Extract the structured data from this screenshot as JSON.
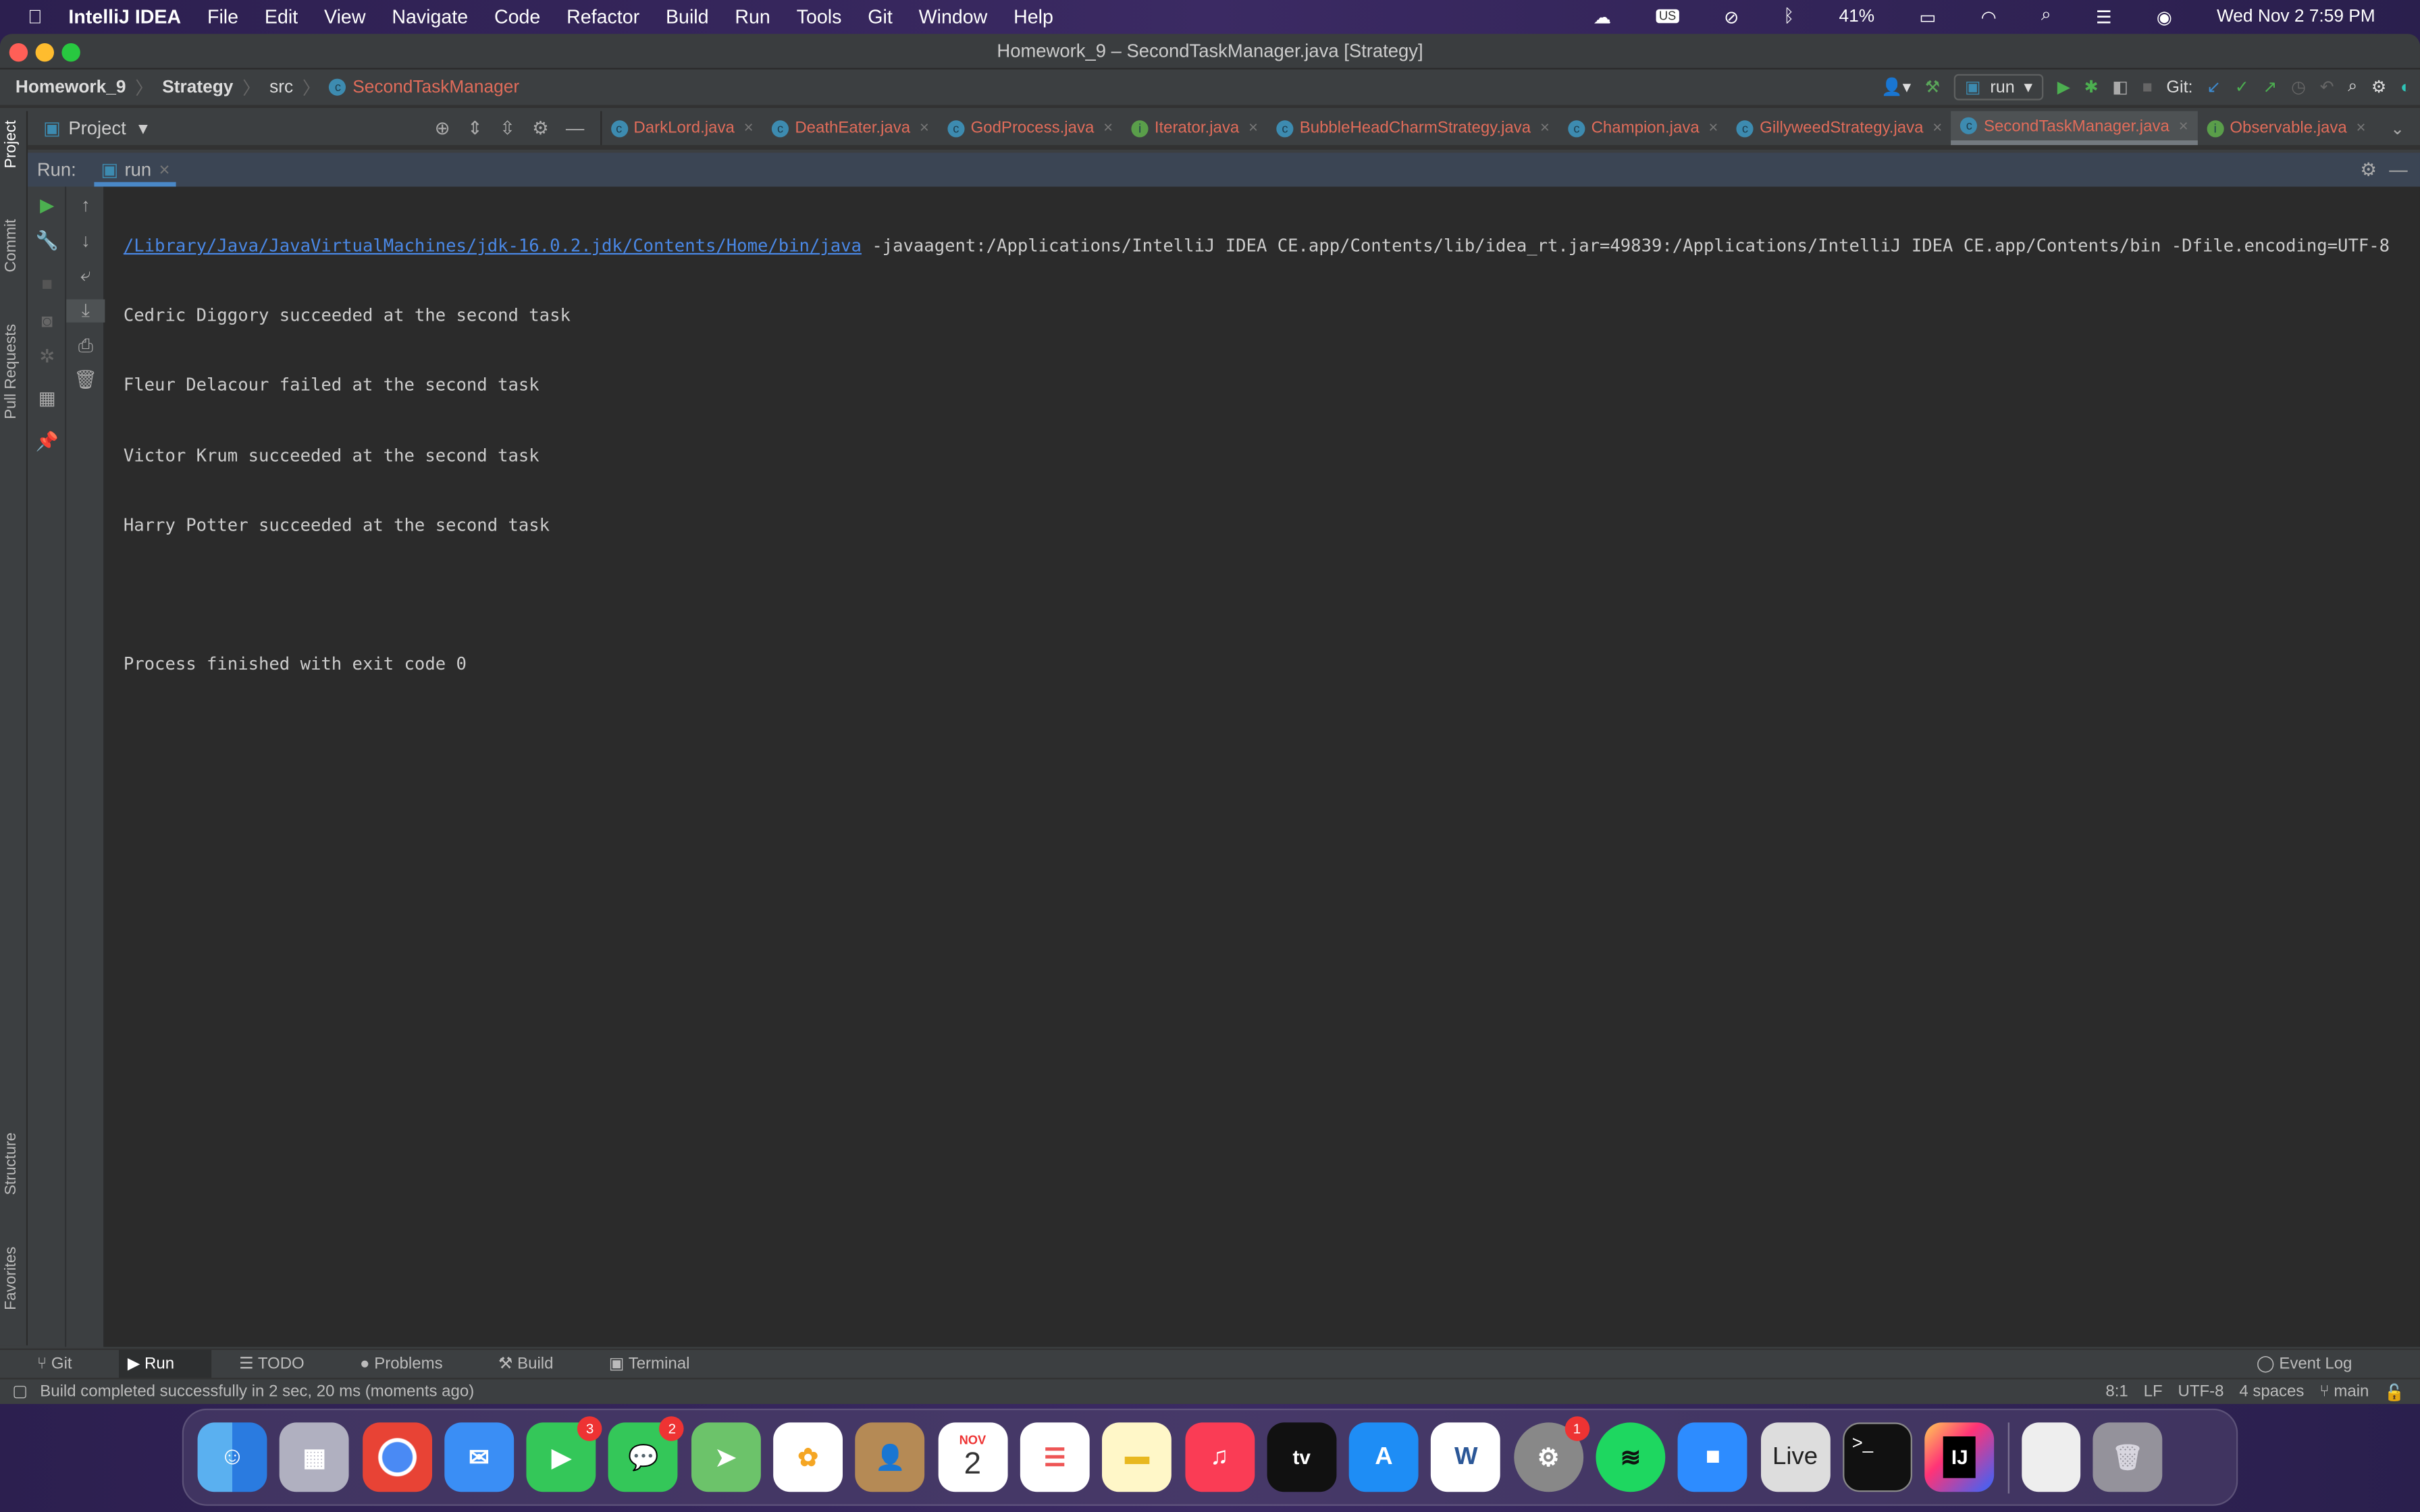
{
  "menubar": {
    "app": "IntelliJ IDEA",
    "items": [
      "File",
      "Edit",
      "View",
      "Navigate",
      "Code",
      "Refactor",
      "Build",
      "Run",
      "Tools",
      "Git",
      "Window",
      "Help"
    ],
    "battery": "41%",
    "datetime": "Wed Nov 2  7:59 PM",
    "input": "US"
  },
  "window": {
    "title": "Homework_9 – SecondTaskManager.java [Strategy]"
  },
  "breadcrumb": [
    "Homework_9",
    "Strategy",
    "src",
    "SecondTaskManager"
  ],
  "toolbar": {
    "run_config": "run",
    "git_label": "Git:"
  },
  "project_panel": {
    "label": "Project"
  },
  "tabs": [
    {
      "label": "DarkLord.java",
      "icon": "C"
    },
    {
      "label": "DeathEater.java",
      "icon": "C"
    },
    {
      "label": "GodProcess.java",
      "icon": "C"
    },
    {
      "label": "Iterator.java",
      "icon": "I"
    },
    {
      "label": "BubbleHeadCharmStrategy.java",
      "icon": "C"
    },
    {
      "label": "Champion.java",
      "icon": "C"
    },
    {
      "label": "GillyweedStrategy.java",
      "icon": "C"
    },
    {
      "label": "SecondTaskManager.java",
      "icon": "C",
      "active": true
    },
    {
      "label": "Observable.java",
      "icon": "I"
    }
  ],
  "left_tools": [
    "Project",
    "Commit",
    "Pull Requests",
    "Structure",
    "Favorites"
  ],
  "run_panel": {
    "label": "Run:",
    "tab": "run"
  },
  "console": {
    "java_path": "/Library/Java/JavaVirtualMachines/jdk-16.0.2.jdk/Contents/Home/bin/java",
    "args": " -javaagent:/Applications/IntelliJ IDEA CE.app/Contents/lib/idea_rt.jar=49839:/Applications/IntelliJ IDEA CE.app/Contents/bin -Dfile.encoding=UTF-8",
    "lines": [
      "Cedric Diggory succeeded at the second task",
      "Fleur Delacour failed at the second task",
      "Victor Krum succeeded at the second task",
      "Harry Potter succeeded at the second task",
      "",
      "Process finished with exit code 0"
    ]
  },
  "bottom_tabs": [
    "Git",
    "Run",
    "TODO",
    "Problems",
    "Build",
    "Terminal"
  ],
  "event_log": "Event Log",
  "status": {
    "message": "Build completed successfully in 2 sec, 20 ms (moments ago)",
    "position": "8:1",
    "line_sep": "LF",
    "encoding": "UTF-8",
    "indent": "4 spaces",
    "branch": "main"
  },
  "dock": {
    "calendar_month": "NOV",
    "calendar_day": "2",
    "facetime_badge": "3",
    "messages_badge": "2",
    "settings_badge": "1",
    "live_label": "Live",
    "terminal_label": ">_",
    "intellij_label": "IJ"
  }
}
